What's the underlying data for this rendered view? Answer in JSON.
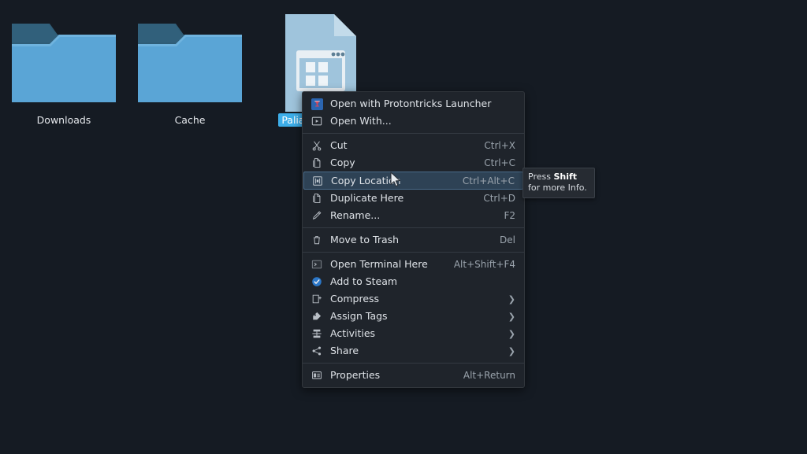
{
  "desktop": {
    "background_color": "#151b23",
    "icons": [
      {
        "name": "Downloads",
        "type": "folder",
        "selected": false
      },
      {
        "name": "Cache",
        "type": "folder",
        "selected": false
      },
      {
        "name": "PaliaLauncher",
        "type": "file",
        "selected": true
      }
    ]
  },
  "context_menu": {
    "background_color": "#1f242b",
    "highlight_color": "#2e4255",
    "groups": [
      {
        "items": [
          {
            "label": "Open with Protontricks Launcher",
            "shortcut": "",
            "icon": "protontricks-icon",
            "submenu": false,
            "highlighted": false
          },
          {
            "label": "Open With...",
            "shortcut": "",
            "icon": "open-with-icon",
            "submenu": false,
            "highlighted": false
          }
        ]
      },
      {
        "items": [
          {
            "label": "Cut",
            "shortcut": "Ctrl+X",
            "icon": "scissors-icon",
            "submenu": false,
            "highlighted": false
          },
          {
            "label": "Copy",
            "shortcut": "Ctrl+C",
            "icon": "copy-icon",
            "submenu": false,
            "highlighted": false
          },
          {
            "label": "Copy Location",
            "shortcut": "Ctrl+Alt+C",
            "icon": "copy-location-icon",
            "submenu": false,
            "highlighted": true
          },
          {
            "label": "Duplicate Here",
            "shortcut": "Ctrl+D",
            "icon": "duplicate-icon",
            "submenu": false,
            "highlighted": false
          },
          {
            "label": "Rename...",
            "shortcut": "F2",
            "icon": "pencil-icon",
            "submenu": false,
            "highlighted": false
          }
        ]
      },
      {
        "items": [
          {
            "label": "Move to Trash",
            "shortcut": "Del",
            "icon": "trash-icon",
            "submenu": false,
            "highlighted": false
          }
        ]
      },
      {
        "items": [
          {
            "label": "Open Terminal Here",
            "shortcut": "Alt+Shift+F4",
            "icon": "terminal-icon",
            "submenu": false,
            "highlighted": false
          },
          {
            "label": "Add to Steam",
            "shortcut": "",
            "icon": "steam-check-icon",
            "submenu": false,
            "highlighted": false
          },
          {
            "label": "Compress",
            "shortcut": "",
            "icon": "compress-icon",
            "submenu": true,
            "highlighted": false
          },
          {
            "label": "Assign Tags",
            "shortcut": "",
            "icon": "tag-icon",
            "submenu": true,
            "highlighted": false
          },
          {
            "label": "Activities",
            "shortcut": "",
            "icon": "activities-icon",
            "submenu": true,
            "highlighted": false
          },
          {
            "label": "Share",
            "shortcut": "",
            "icon": "share-icon",
            "submenu": true,
            "highlighted": false
          }
        ]
      },
      {
        "items": [
          {
            "label": "Properties",
            "shortcut": "Alt+Return",
            "icon": "properties-icon",
            "submenu": false,
            "highlighted": false
          }
        ]
      }
    ]
  },
  "tooltip": {
    "prefix": "Press ",
    "emphasis": "Shift",
    "suffix": " for more Info."
  }
}
